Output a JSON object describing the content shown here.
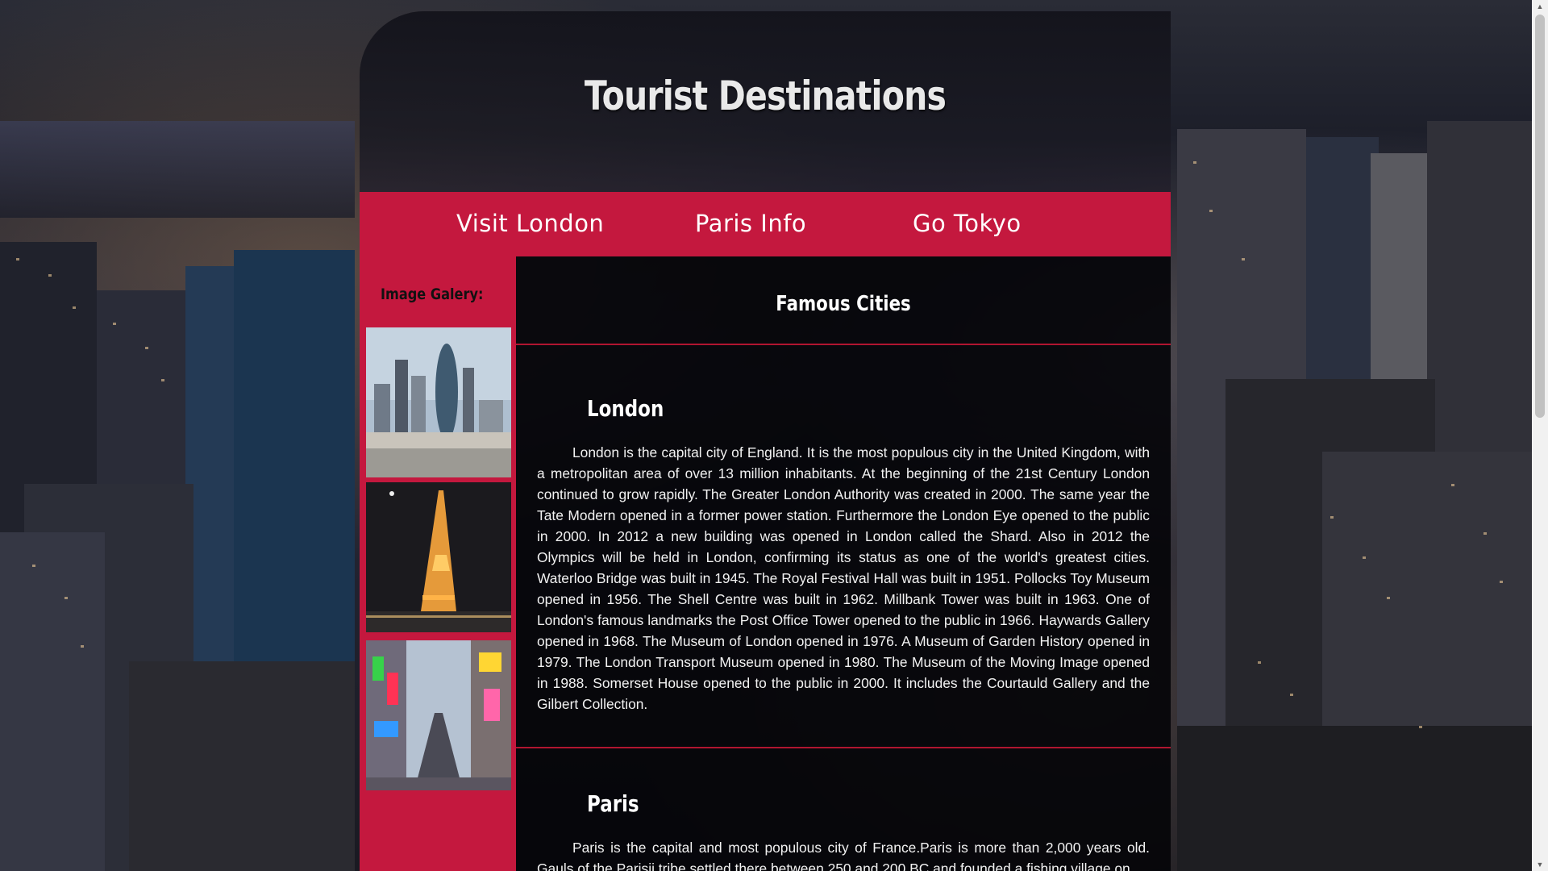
{
  "site": {
    "title": "Tourist Destinations"
  },
  "nav": {
    "items": [
      {
        "label": "Visit London"
      },
      {
        "label": "Paris Info"
      },
      {
        "label": "Go Tokyo"
      }
    ]
  },
  "sidebar": {
    "gallery_label": "Image Galery:"
  },
  "main": {
    "heading": "Famous Cities",
    "sections": [
      {
        "title": "London",
        "text": "London is the capital city of England. It is the most populous city in the United Kingdom, with a metropolitan area of over 13 million inhabitants. At the beginning of the 21st Century London continued to grow rapidly. The Greater London Authority was created in 2000. The same year the Tate Modern opened in a former power station. Furthermore the London Eye opened to the public in 2000. In 2012 a new building was opened in London called the Shard. Also in 2012 the Olympics will be held in London, confirming its status as one of the world's greatest cities. Waterloo Bridge was built in 1945. The Royal Festival Hall was built in 1951. Pollocks Toy Museum opened in 1956. The Shell Centre was built in 1962. Millbank Tower was built in 1963. One of London's famous landmarks the Post Office Tower opened to the public in 1966. Haywards Gallery opened in 1968. The Museum of London opened in 1976. A Museum of Garden History opened in 1979. The London Transport Museum opened in 1980. The Museum of the Moving Image opened in 1988. Somerset House opened to the public in 2000. It includes the Courtauld Gallery and the Gilbert Collection."
      },
      {
        "title": "Paris",
        "text": "Paris is the capital and most populous city of France.Paris is more than 2,000 years old. Gauls of the Parisii tribe settled there between 250 and 200 BC and founded a fishing village on"
      }
    ]
  },
  "colors": {
    "accent": "#c4183e",
    "divider": "#b01530"
  }
}
